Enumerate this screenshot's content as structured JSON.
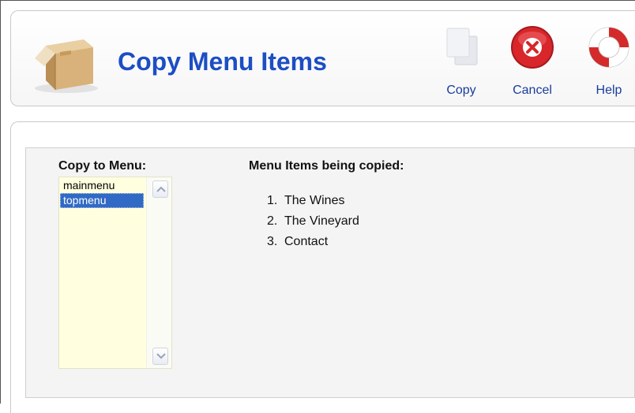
{
  "toolbar": {
    "title": "Copy Menu Items",
    "buttons": {
      "copy": {
        "label": "Copy",
        "icon": "copy-icon"
      },
      "cancel": {
        "label": "Cancel",
        "icon": "cancel-icon"
      },
      "help": {
        "label": "Help",
        "icon": "help-lifebuoy-icon"
      }
    },
    "logo_icon": "package-box-icon"
  },
  "form": {
    "copy_to_label": "Copy to Menu:",
    "menu_options": [
      "mainmenu",
      "topmenu"
    ],
    "selected_menu": "topmenu",
    "items_label": "Menu Items being copied:",
    "items": [
      {
        "num": "1.",
        "title": "The Wines"
      },
      {
        "num": "2.",
        "title": "The Vineyard"
      },
      {
        "num": "3.",
        "title": "Contact"
      }
    ]
  },
  "colors": {
    "title": "#1c4ec4",
    "link": "#1a3d9a",
    "selection": "#316ac5",
    "listbox_bg": "#ffffe0",
    "panel_bg": "#f4f4f4"
  }
}
